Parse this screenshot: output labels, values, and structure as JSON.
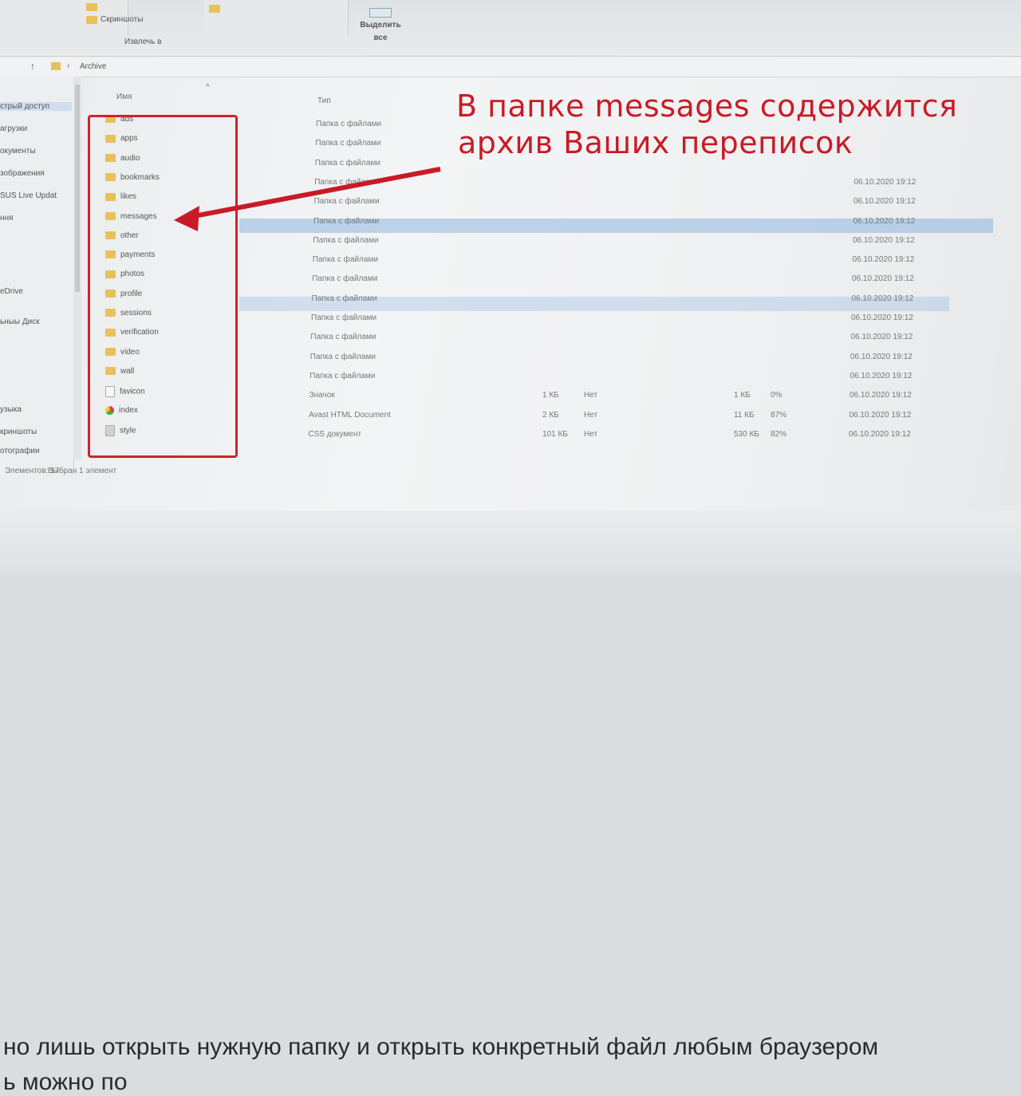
{
  "ribbon": {
    "item_1": "Скриншоты",
    "item_2": "Извлечь в",
    "select_all": "Выделить\nвсе"
  },
  "address": {
    "path": "Archive"
  },
  "nav": {
    "items": [
      "стрый доступ",
      "агрузки",
      "окументы",
      "зображения",
      "SUS Live Updat",
      "ння",
      "eDrive",
      "ьныы Диск",
      "узыка",
      "криншоты",
      "отографии"
    ]
  },
  "columns": {
    "name": "Имя",
    "type": "Тип"
  },
  "files": [
    {
      "name": "ads",
      "icon": "folder-icon",
      "type": "Папка с файлами",
      "date": ""
    },
    {
      "name": "apps",
      "icon": "folder-icon",
      "type": "Папка с файлами",
      "date": ""
    },
    {
      "name": "audio",
      "icon": "folder-icon",
      "type": "Папка с файлами",
      "date": ""
    },
    {
      "name": "bookmarks",
      "icon": "folder-icon",
      "type": "Папка с файлами",
      "date": "06.10.2020 19:12"
    },
    {
      "name": "likes",
      "icon": "folder-icon",
      "type": "Папка с файлами",
      "date": "06.10.2020 19:12"
    },
    {
      "name": "messages",
      "icon": "folder-icon",
      "type": "Папка с файлами",
      "date": "06.10.2020 19:12"
    },
    {
      "name": "other",
      "icon": "folder-icon",
      "type": "Папка с файлами",
      "date": "06.10.2020 19:12"
    },
    {
      "name": "payments",
      "icon": "folder-icon",
      "type": "Папка с файлами",
      "date": "06.10.2020 19:12"
    },
    {
      "name": "photos",
      "icon": "folder-icon",
      "type": "Папка с файлами",
      "date": "06.10.2020 19:12"
    },
    {
      "name": "profile",
      "icon": "folder-icon",
      "type": "Папка с файлами",
      "date": "06.10.2020 19:12"
    },
    {
      "name": "sessions",
      "icon": "folder-icon",
      "type": "Папка с файлами",
      "date": "06.10.2020 19:12"
    },
    {
      "name": "verification",
      "icon": "folder-icon",
      "type": "Папка с файлами",
      "date": "06.10.2020 19:12"
    },
    {
      "name": "video",
      "icon": "folder-icon",
      "type": "Папка с файлами",
      "date": "06.10.2020 19:12"
    },
    {
      "name": "wall",
      "icon": "folder-icon",
      "type": "Папка с файлами",
      "date": "06.10.2020 19:12"
    },
    {
      "name": "favicon",
      "icon": "file-icon",
      "type": "Значок",
      "date": "06.10.2020 19:12",
      "size": "1 КБ",
      "packed": "Нет",
      "csize": "1 КБ",
      "ratio": "0%"
    },
    {
      "name": "index",
      "icon": "chrome-icon",
      "type": "Avast HTML Document",
      "date": "06.10.2020 19:12",
      "size": "2 КБ",
      "packed": "Нет",
      "csize": "11 КБ",
      "ratio": "87%"
    },
    {
      "name": "style",
      "icon": "css-icon",
      "type": "CSS документ",
      "date": "06.10.2020 19:12",
      "size": "101 КБ",
      "packed": "Нет",
      "csize": "530 КБ",
      "ratio": "82%"
    }
  ],
  "statusbar": {
    "count": "Элементов: 17",
    "selected": "Выбран 1 элемент"
  },
  "annotation": {
    "line1": "В папке messages содержится",
    "line2": "архив Ваших переписок"
  },
  "page_text": {
    "line1": "но лишь открыть нужную папку и открыть конкретный файл любым браузером",
    "line2": "ь можно по"
  },
  "colors": {
    "annotation_red": "#c81b27",
    "folder_yellow": "#e8c15a",
    "selection_blue": "#78aadc"
  }
}
